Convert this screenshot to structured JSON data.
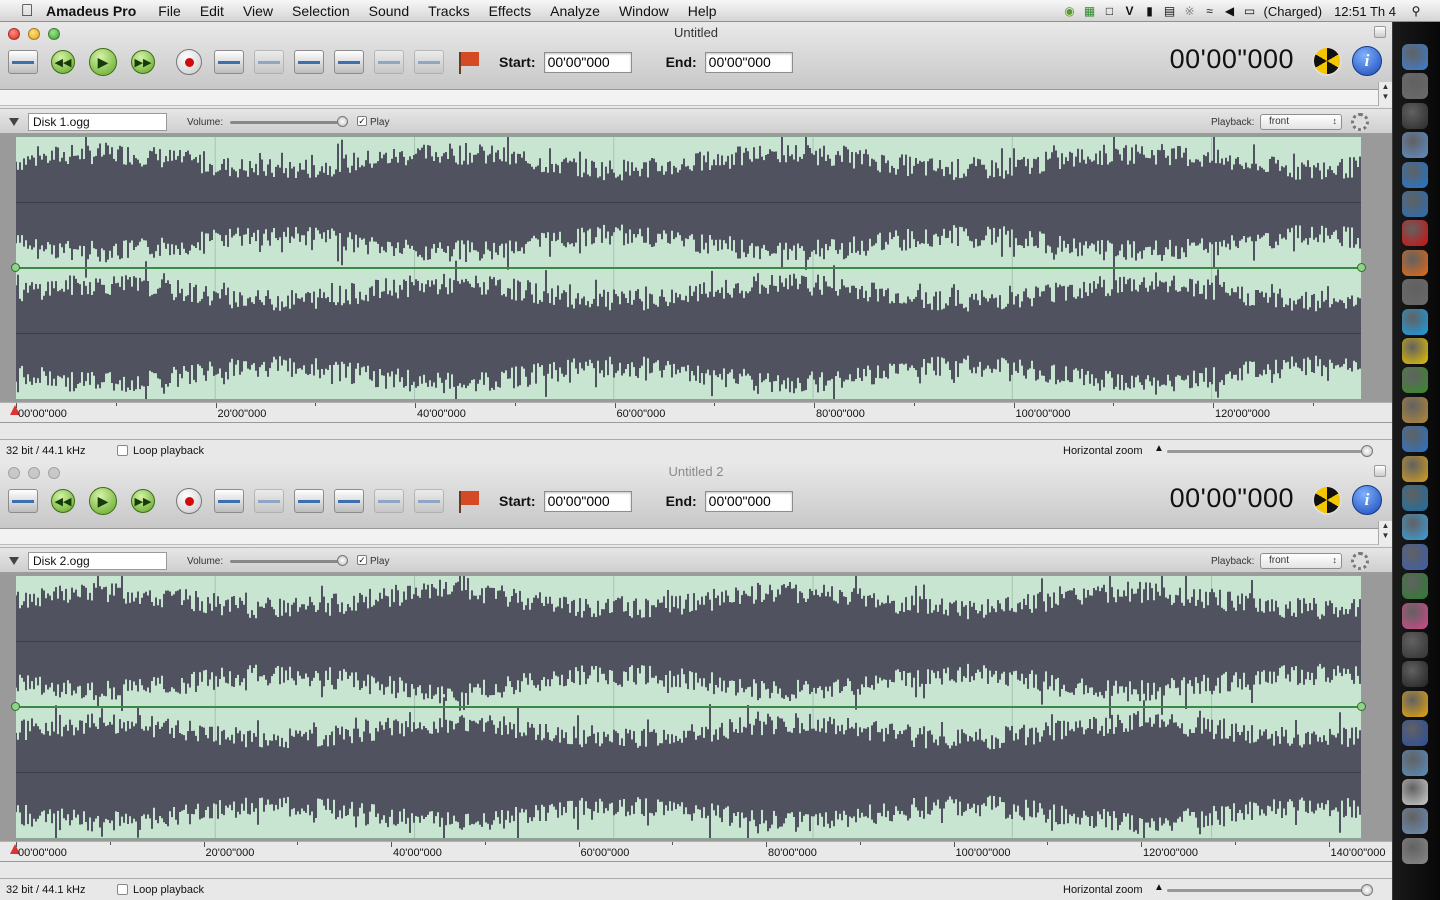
{
  "menubar": {
    "app": "Amadeus Pro",
    "items": [
      "File",
      "Edit",
      "View",
      "Selection",
      "Sound",
      "Tracks",
      "Effects",
      "Analyze",
      "Window",
      "Help"
    ],
    "battery": "(Charged)",
    "clock": "12:51 Th 4"
  },
  "windows": [
    {
      "title": "Untitled",
      "start_label": "Start:",
      "start": "00'00\"000",
      "end_label": "End:",
      "end": "00'00\"000",
      "time": "00'00\"000",
      "track": {
        "name": "Disk 1.ogg",
        "volume_label": "Volume:",
        "play_label": "Play",
        "playback_label": "Playback:",
        "playback": "front"
      },
      "ruler": [
        "00'00\"000",
        "20'00\"000",
        "40'00\"000",
        "60'00\"000",
        "80'00\"000",
        "100'00\"000",
        "120'00\"000"
      ],
      "format": "32 bit / 44.1 kHz",
      "loop": "Loop playback",
      "hzoom": "Horizontal zoom"
    },
    {
      "title": "Untitled 2",
      "start_label": "Start:",
      "start": "00'00\"000",
      "end_label": "End:",
      "end": "00'00\"000",
      "time": "00'00\"000",
      "track": {
        "name": "Disk 2.ogg",
        "volume_label": "Volume:",
        "play_label": "Play",
        "playback_label": "Playback:",
        "playback": "front"
      },
      "ruler": [
        "00'00\"000",
        "20'00\"000",
        "40'00\"000",
        "60'00\"000",
        "80'00\"000",
        "100'00\"000",
        "120'00\"000",
        "140'00\"000"
      ],
      "format": "32 bit / 44.1 kHz",
      "loop": "Loop playback",
      "hzoom": "Horizontal zoom"
    }
  ],
  "colors": {
    "wave_bg": "#c8e5d2",
    "wave_fill": "#50535f",
    "grid": "#a7c4b2",
    "envelope": "#3a8a45",
    "dock": "#111111"
  },
  "dock_icons": [
    "finder-icon",
    "photo-icon",
    "terminal-icon",
    "xcode-icon",
    "teamviewer-icon",
    "thunderbird-icon",
    "opera-icon",
    "firefox-icon",
    "sysprefs-icon",
    "skype-icon",
    "adium-icon",
    "gear-person-icon",
    "archive-icon",
    "transmit-icon",
    "mobile-icon",
    "wordpress-icon",
    "dashboard-icon",
    "virtualbox-icon",
    "crossover-icon",
    "perian-icon",
    "kindle-icon",
    "console-icon",
    "fireworks-icon",
    "bbedit-icon",
    "screenflow-icon",
    "character-icon",
    "apps-folder-icon",
    "trash-icon"
  ]
}
